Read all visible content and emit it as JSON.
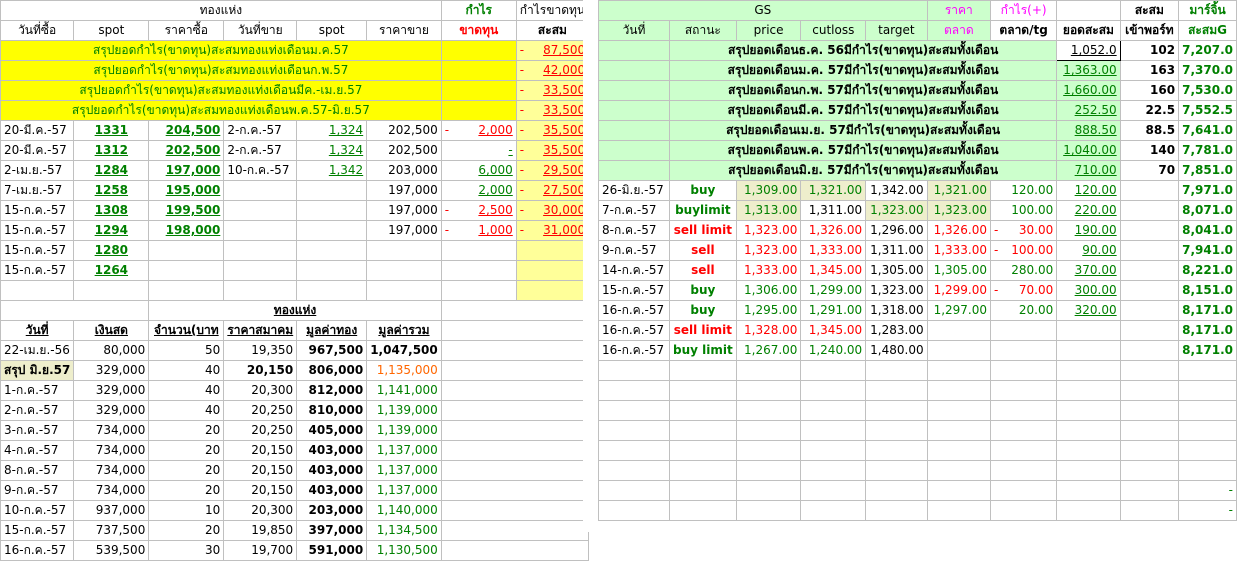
{
  "left_sheet": {
    "group_header": {
      "gold_bar": "ทองแห่ง",
      "profit": "กำไร",
      "profit_loss_total": "กำไรขาดทุน"
    },
    "col_headers": [
      "วันที่ซื้อ",
      "spot",
      "ราคาซื้อ",
      "วันที่ขาย",
      "spot",
      "ราคาขาย",
      "ขาดทุน",
      "สะสม"
    ],
    "summary_rows": [
      {
        "label": "สรุปยอดกำไร(ขาดทุน)สะสมทองแท่งเดือนม.ค.57",
        "sign": "-",
        "value": "87,500"
      },
      {
        "label": "สรุปยอดกำไร(ขาดทุน)สะสมทองแท่งเดือนก.พ.57",
        "sign": "-",
        "value": "42,000"
      },
      {
        "label": "สรุปยอดกำไร(ขาดทุน)สะสมทองแท่งเดือนมีค.-เม.ย.57",
        "sign": "-",
        "value": "33,500"
      },
      {
        "label": "สรุปยอดกำไร(ขาดทุน)สะสมทองแท่งเดือนพ.ค.57-มิ.ย.57",
        "sign": "-",
        "value": "33,500"
      }
    ],
    "trades": [
      {
        "buy_date": "20-มี.ค.-57",
        "buy_spot": "1331",
        "buy_price": "204,500",
        "sell_date": "2-ก.ค.-57",
        "sell_spot": "1,324",
        "sell_price": "202,500",
        "pl_sign": "-",
        "pl": "2,000",
        "cum_sign": "-",
        "cum": "35,500"
      },
      {
        "buy_date": "20-มี.ค.-57",
        "buy_spot": "1312",
        "buy_price": "202,500",
        "sell_date": "2-ก.ค.-57",
        "sell_spot": "1,324",
        "sell_price": "202,500",
        "pl_sign": "",
        "pl": "-",
        "cum_sign": "-",
        "cum": "35,500"
      },
      {
        "buy_date": "2-เม.ย.-57",
        "buy_spot": "1284",
        "buy_price": "197,000",
        "sell_date": "10-ก.ค.-57",
        "sell_spot": "1,342",
        "sell_price": "203,000",
        "pl_sign": "",
        "pl": "6,000",
        "cum_sign": "-",
        "cum": "29,500"
      },
      {
        "buy_date": "7-เม.ย.-57",
        "buy_spot": "1258",
        "buy_price": "195,000",
        "sell_date": "",
        "sell_spot": "",
        "sell_price": "197,000",
        "pl_sign": "",
        "pl": "2,000",
        "cum_sign": "-",
        "cum": "27,500"
      },
      {
        "buy_date": "15-ก.ค.-57",
        "buy_spot": "1308",
        "buy_price": "199,500",
        "sell_date": "",
        "sell_spot": "",
        "sell_price": "197,000",
        "pl_sign": "-",
        "pl": "2,500",
        "cum_sign": "-",
        "cum": "30,000"
      },
      {
        "buy_date": "15-ก.ค.-57",
        "buy_spot": "1294",
        "buy_price": "198,000",
        "sell_date": "",
        "sell_spot": "",
        "sell_price": "197,000",
        "pl_sign": "-",
        "pl": "1,000",
        "cum_sign": "-",
        "cum": "31,000"
      },
      {
        "buy_date": "15-ก.ค.-57",
        "buy_spot": "1280",
        "buy_price": "",
        "sell_date": "",
        "sell_spot": "",
        "sell_price": "",
        "pl_sign": "",
        "pl": "",
        "cum_sign": "",
        "cum": ""
      },
      {
        "buy_date": "15-ก.ค.-57",
        "buy_spot": "1264",
        "buy_price": "",
        "sell_date": "",
        "sell_spot": "",
        "sell_price": "",
        "pl_sign": "",
        "pl": "",
        "cum_sign": "",
        "cum": ""
      }
    ],
    "holdings_title": "ทองแห่ง",
    "holdings_headers": [
      "วันที่",
      "เงินสด",
      "จำนวน(บาท",
      "ราคาสมาคม",
      "มูลค่าทอง",
      "มูลค่ารวม"
    ],
    "holdings": [
      {
        "date": "22-เม.ย.-56",
        "cash": "80,000",
        "qty": "50",
        "price": "19,350",
        "gold_value": "967,500",
        "total": "1,047,500"
      },
      {
        "date": "สรุป มิ.ย.57",
        "cash": "329,000",
        "qty": "40",
        "price": "20,150",
        "gold_value": "806,000",
        "total": "1,135,000"
      },
      {
        "date": "1-ก.ค.-57",
        "cash": "329,000",
        "qty": "40",
        "price": "20,300",
        "gold_value": "812,000",
        "total": "1,141,000"
      },
      {
        "date": "2-ก.ค.-57",
        "cash": "329,000",
        "qty": "40",
        "price": "20,250",
        "gold_value": "810,000",
        "total": "1,139,000"
      },
      {
        "date": "3-ก.ค.-57",
        "cash": "734,000",
        "qty": "20",
        "price": "20,250",
        "gold_value": "405,000",
        "total": "1,139,000"
      },
      {
        "date": "4-ก.ค.-57",
        "cash": "734,000",
        "qty": "20",
        "price": "20,150",
        "gold_value": "403,000",
        "total": "1,137,000"
      },
      {
        "date": "8-ก.ค.-57",
        "cash": "734,000",
        "qty": "20",
        "price": "20,150",
        "gold_value": "403,000",
        "total": "1,137,000"
      },
      {
        "date": "9-ก.ค.-57",
        "cash": "734,000",
        "qty": "20",
        "price": "20,150",
        "gold_value": "403,000",
        "total": "1,137,000"
      },
      {
        "date": "10-ก.ค.-57",
        "cash": "937,000",
        "qty": "10",
        "price": "20,300",
        "gold_value": "203,000",
        "total": "1,140,000"
      },
      {
        "date": "15-ก.ค.-57",
        "cash": "737,500",
        "qty": "20",
        "price": "19,850",
        "gold_value": "397,000",
        "total": "1,134,500"
      },
      {
        "date": "16-ก.ค.-57",
        "cash": "539,500",
        "qty": "30",
        "price": "19,700",
        "gold_value": "591,000",
        "total": "1,130,500"
      }
    ]
  },
  "right_sheet": {
    "group_header": {
      "gs": "GS",
      "market_price": "ราคา",
      "profit_plus": "กำไร(+)",
      "cum": "สะสม",
      "margin": "มาร์จิ้น"
    },
    "col_headers": [
      "วันที่",
      "สถานะ",
      "price",
      "cutloss",
      "target",
      "ตลาด",
      "ตลาด/tg",
      "ยอดสะสม",
      "เข้าพอร์ท",
      "สะสมG"
    ],
    "summary_rows": [
      {
        "label": "สรุปยอดเดือนธ.ค. 56มีกำไร(ขาดทุน)สะสมทั้งเดือน",
        "cum": "1,052.0",
        "port": "102",
        "margin": "7,207.0"
      },
      {
        "label": "สรุปยอดเดือนม.ค. 57มีกำไร(ขาดทุน)สะสมทั้งเดือน",
        "cum": "1,363.00",
        "port": "163",
        "margin": "7,370.0"
      },
      {
        "label": "สรุปยอดเดือนก.พ. 57มีกำไร(ขาดทุน)สะสมทั้งเดือน",
        "cum": "1,660.00",
        "port": "160",
        "margin": "7,530.0"
      },
      {
        "label": "สรุปยอดเดือนมี.ค. 57มีกำไร(ขาดทุน)สะสมทั้งเดือน",
        "cum": "252.50",
        "port": "22.5",
        "margin": "7,552.5"
      },
      {
        "label": "สรุปยอดเดือนเม.ย. 57มีกำไร(ขาดทุน)สะสมทั้งเดือน",
        "cum": "888.50",
        "port": "88.5",
        "margin": "7,641.0"
      },
      {
        "label": "สรุปยอดเดือนพ.ค. 57มีกำไร(ขาดทุน)สะสมทั้งเดือน",
        "cum": "1,040.00",
        "port": "140",
        "margin": "7,781.0"
      },
      {
        "label": "สรุปยอดเดือนมิ.ย. 57มีกำไร(ขาดทุน)สะสมทั้งเดือน",
        "cum": "710.00",
        "port": "70",
        "margin": "7,851.0"
      }
    ],
    "trades": [
      {
        "date": "26-มิ.ย.-57",
        "status": "buy",
        "price": "1,309.00",
        "cutloss": "1,321.00",
        "target": "1,342.00",
        "market": "1,321.00",
        "pl_sign": "",
        "pl": "120.00",
        "cum": "120.00",
        "margin": "7,971.0"
      },
      {
        "date": "7-ก.ค.-57",
        "status": "buylimit",
        "price": "1,313.00",
        "cutloss": "1,311.00",
        "target": "1,323.00",
        "market": "1,323.00",
        "pl_sign": "",
        "pl": "100.00",
        "cum": "220.00",
        "margin": "8,071.0"
      },
      {
        "date": "8-ก.ค.-57",
        "status": "sell limit",
        "price": "1,323.00",
        "cutloss": "1,326.00",
        "target": "1,296.00",
        "market": "1,326.00",
        "pl_sign": "-",
        "pl": "30.00",
        "cum": "190.00",
        "margin": "8,041.0"
      },
      {
        "date": "9-ก.ค.-57",
        "status": "sell",
        "price": "1,323.00",
        "cutloss": "1,333.00",
        "target": "1,311.00",
        "market": "1,333.00",
        "pl_sign": "-",
        "pl": "100.00",
        "cum": "90.00",
        "margin": "7,941.0"
      },
      {
        "date": "14-ก.ค.-57",
        "status": "sell",
        "price": "1,333.00",
        "cutloss": "1,345.00",
        "target": "1,305.00",
        "market": "1,305.00",
        "pl_sign": "",
        "pl": "280.00",
        "cum": "370.00",
        "margin": "8,221.0"
      },
      {
        "date": "15-ก.ค.-57",
        "status": "buy",
        "price": "1,306.00",
        "cutloss": "1,299.00",
        "target": "1,323.00",
        "market": "1,299.00",
        "pl_sign": "-",
        "pl": "70.00",
        "cum": "300.00",
        "margin": "8,151.0"
      },
      {
        "date": "16-ก.ค.-57",
        "status": "buy",
        "price": "1,295.00",
        "cutloss": "1,291.00",
        "target": "1,318.00",
        "market": "1,297.00",
        "pl_sign": "",
        "pl": "20.00",
        "cum": "320.00",
        "margin": "8,171.0"
      },
      {
        "date": "16-ก.ค.-57",
        "status": "sell limit",
        "price": "1,328.00",
        "cutloss": "1,345.00",
        "target": "1,283.00",
        "market": "",
        "pl_sign": "",
        "pl": "",
        "cum": "",
        "margin": "8,171.0"
      },
      {
        "date": "16-ก.ค.-57",
        "status": "buy limit",
        "price": "1,267.00",
        "cutloss": "1,240.00",
        "target": "1,480.00",
        "market": "",
        "pl_sign": "",
        "pl": "",
        "cum": "",
        "margin": "8,171.0"
      }
    ],
    "trailing_dash": "-"
  },
  "colors": {
    "yellow": "#ffff00",
    "pale_yellow": "#ffff99",
    "light_green": "#ccffcc",
    "red": "#ff0000",
    "green": "#008000"
  }
}
